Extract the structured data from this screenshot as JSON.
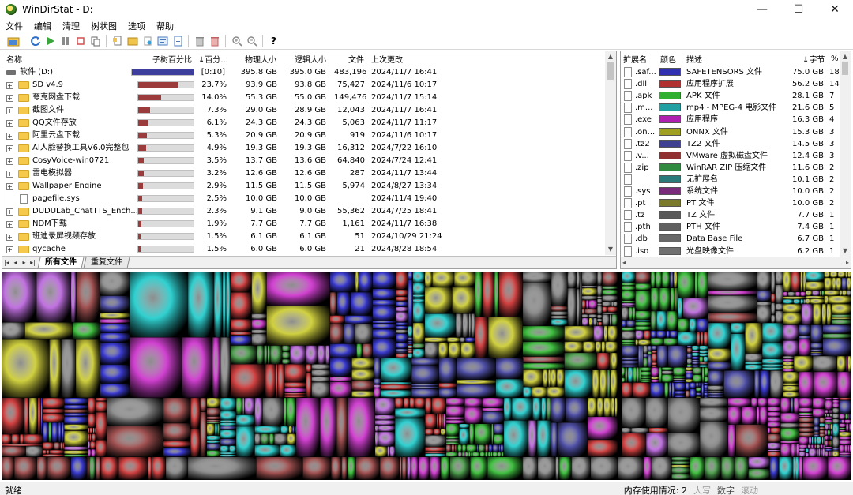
{
  "window": {
    "title": "WinDirStat - D:",
    "min": "—",
    "max": "☐",
    "close": "✕"
  },
  "menu": [
    "文件",
    "编辑",
    "清理",
    "树状图",
    "选项",
    "帮助"
  ],
  "toolbar_icons": [
    "open-icon",
    "refresh-icon",
    "play-icon",
    "pause-icon",
    "stop-icon",
    "refresh-selected-icon",
    "copy-path-icon",
    "explorer-icon",
    "cmd-icon",
    "properties-icon",
    "delete-recycle-icon",
    "delete-icon",
    "zoom-in-icon",
    "zoom-out-icon",
    "help-icon"
  ],
  "tree": {
    "headers": {
      "name": "名称",
      "subtree_pct": "子树百分比",
      "pct": "↓百分...",
      "physical": "物理大小",
      "logical": "逻辑大小",
      "files": "文件",
      "modified": "上次更改"
    },
    "root": {
      "name": "软件 (D:)",
      "subtree": "[0:10]",
      "bar": 1.0,
      "physical": "395.8 GB",
      "logical": "395.0 GB",
      "files": "483,196",
      "modified": "2024/11/7  16:41"
    },
    "rows": [
      {
        "name": "SD v4.9",
        "bar": 0.237,
        "pct": "23.7%",
        "physical": "93.9 GB",
        "logical": "93.8 GB",
        "files": "75,427",
        "modified": "2024/11/6  10:17",
        "folder": true
      },
      {
        "name": "夸克网盘下载",
        "bar": 0.14,
        "pct": "14.0%",
        "physical": "55.3 GB",
        "logical": "55.0 GB",
        "files": "149,476",
        "modified": "2024/11/7  15:14",
        "folder": true
      },
      {
        "name": "截图文件",
        "bar": 0.073,
        "pct": "7.3%",
        "physical": "29.0 GB",
        "logical": "28.9 GB",
        "files": "12,043",
        "modified": "2024/11/7  16:41",
        "folder": true
      },
      {
        "name": "QQ文件存放",
        "bar": 0.061,
        "pct": "6.1%",
        "physical": "24.3 GB",
        "logical": "24.3 GB",
        "files": "5,063",
        "modified": "2024/11/7  11:17",
        "folder": true
      },
      {
        "name": "阿里云盘下载",
        "bar": 0.053,
        "pct": "5.3%",
        "physical": "20.9 GB",
        "logical": "20.9 GB",
        "files": "919",
        "modified": "2024/11/6  10:17",
        "folder": true
      },
      {
        "name": "AI人脸替换工具V6.0完整包",
        "bar": 0.049,
        "pct": "4.9%",
        "physical": "19.3 GB",
        "logical": "19.3 GB",
        "files": "16,312",
        "modified": "2024/7/22  16:10",
        "folder": true
      },
      {
        "name": "CosyVoice-win0721",
        "bar": 0.035,
        "pct": "3.5%",
        "physical": "13.7 GB",
        "logical": "13.6 GB",
        "files": "64,840",
        "modified": "2024/7/24  12:41",
        "folder": true
      },
      {
        "name": "雷电模拟器",
        "bar": 0.032,
        "pct": "3.2%",
        "physical": "12.6 GB",
        "logical": "12.6 GB",
        "files": "287",
        "modified": "2024/11/7  13:44",
        "folder": true
      },
      {
        "name": "Wallpaper Engine",
        "bar": 0.029,
        "pct": "2.9%",
        "physical": "11.5 GB",
        "logical": "11.5 GB",
        "files": "5,974",
        "modified": "2024/8/27  13:34",
        "folder": true
      },
      {
        "name": "pagefile.sys",
        "bar": 0.025,
        "pct": "2.5%",
        "physical": "10.0 GB",
        "logical": "10.0 GB",
        "files": "",
        "modified": "2024/11/4  19:40",
        "folder": false
      },
      {
        "name": "DUDULab_ChatTTS_Ench...",
        "bar": 0.023,
        "pct": "2.3%",
        "physical": "9.1 GB",
        "logical": "9.0 GB",
        "files": "55,362",
        "modified": "2024/7/25  18:41",
        "folder": true
      },
      {
        "name": "NDM下载",
        "bar": 0.019,
        "pct": "1.9%",
        "physical": "7.7 GB",
        "logical": "7.7 GB",
        "files": "1,161",
        "modified": "2024/11/7  16:38",
        "folder": true
      },
      {
        "name": "班迪录屏视频存放",
        "bar": 0.015,
        "pct": "1.5%",
        "physical": "6.1 GB",
        "logical": "6.1 GB",
        "files": "51",
        "modified": "2024/10/29  21:24",
        "folder": true
      },
      {
        "name": "qycache",
        "bar": 0.015,
        "pct": "1.5%",
        "physical": "6.0 GB",
        "logical": "6.0 GB",
        "files": "21",
        "modified": "2024/8/28  18:54",
        "folder": true
      }
    ],
    "tabs": [
      "所有文件",
      "重复文件"
    ],
    "tab_nav": [
      "|◂",
      "◂",
      "▸",
      "▸|"
    ]
  },
  "ext": {
    "headers": {
      "ext": "扩展名",
      "color": "颜色",
      "desc": "描述",
      "bytes": "↓字节",
      "pct": "%"
    },
    "rows": [
      {
        "ext": ".saf...",
        "color": "#3030b0",
        "desc": "SAFETENSORS 文件",
        "bytes": "75.0 GB",
        "pct": "18"
      },
      {
        "ext": ".dll",
        "color": "#b03030",
        "desc": "应用程序扩展",
        "bytes": "56.2 GB",
        "pct": "14"
      },
      {
        "ext": ".apk",
        "color": "#30b030",
        "desc": "APK 文件",
        "bytes": "28.1 GB",
        "pct": "7"
      },
      {
        "ext": ".m...",
        "color": "#20a0a0",
        "desc": "mp4 - MPEG-4 电影文件",
        "bytes": "21.6 GB",
        "pct": "5"
      },
      {
        "ext": ".exe",
        "color": "#b020b0",
        "desc": "应用程序",
        "bytes": "16.3 GB",
        "pct": "4"
      },
      {
        "ext": ".on...",
        "color": "#a0a020",
        "desc": "ONNX 文件",
        "bytes": "15.3 GB",
        "pct": "3"
      },
      {
        "ext": ".tz2",
        "color": "#404090",
        "desc": "TZ2 文件",
        "bytes": "14.5 GB",
        "pct": "3"
      },
      {
        "ext": ".v...",
        "color": "#903030",
        "desc": "VMware 虚拟磁盘文件",
        "bytes": "12.4 GB",
        "pct": "3"
      },
      {
        "ext": ".zip",
        "color": "#308a40",
        "desc": "WinRAR ZIP 压缩文件",
        "bytes": "11.6 GB",
        "pct": "2"
      },
      {
        "ext": "",
        "color": "#2a7a7a",
        "desc": "无扩展名",
        "bytes": "10.1 GB",
        "pct": "2"
      },
      {
        "ext": ".sys",
        "color": "#7a2a7a",
        "desc": "系统文件",
        "bytes": "10.0 GB",
        "pct": "2"
      },
      {
        "ext": ".pt",
        "color": "#7a7a2a",
        "desc": "PT 文件",
        "bytes": "10.0 GB",
        "pct": "2"
      },
      {
        "ext": ".tz",
        "color": "#5a5a5a",
        "desc": "TZ 文件",
        "bytes": "7.7 GB",
        "pct": "1"
      },
      {
        "ext": ".pth",
        "color": "#606060",
        "desc": "PTH 文件",
        "bytes": "7.4 GB",
        "pct": "1"
      },
      {
        "ext": ".db",
        "color": "#686868",
        "desc": "Data Base File",
        "bytes": "6.7 GB",
        "pct": "1"
      },
      {
        "ext": ".iso",
        "color": "#707070",
        "desc": "光盘映像文件",
        "bytes": "6.2 GB",
        "pct": "1"
      }
    ]
  },
  "status": {
    "text": "就绪",
    "memory": "内存使用情况: 2",
    "indicators": [
      "大写",
      "数字",
      "滚动"
    ]
  }
}
